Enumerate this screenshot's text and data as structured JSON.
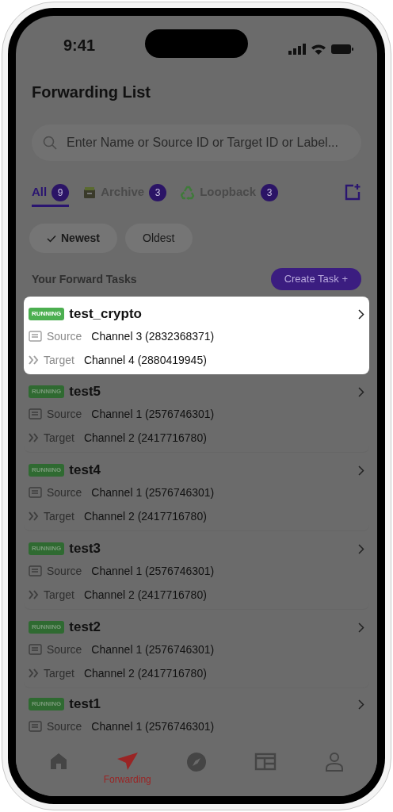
{
  "status_bar": {
    "time": "9:41"
  },
  "title": "Forwarding List",
  "search": {
    "placeholder": "Enter Name or Source ID or Target ID or Label..."
  },
  "tabs": [
    {
      "kind": "plain",
      "label": "All",
      "count": "9",
      "selected": true
    },
    {
      "kind": "archive",
      "label": "Archive",
      "count": "3",
      "selected": false
    },
    {
      "kind": "loopback",
      "label": "Loopback",
      "count": "3",
      "selected": false
    }
  ],
  "sort_chips": [
    {
      "label": "Newest",
      "selected": true
    },
    {
      "label": "Oldest",
      "selected": false
    }
  ],
  "section": {
    "title": "Your Forward Tasks",
    "button": "Create Task +"
  },
  "tasks": [
    {
      "status": "RUNNING",
      "name": "test_crypto",
      "highlighted": true,
      "source_label": "Source",
      "source": "Channel 3 (2832368371)",
      "target_label": "Target",
      "target": "Channel 4 (2880419945)"
    },
    {
      "status": "RUNNING",
      "name": "test5",
      "highlighted": false,
      "source_label": "Source",
      "source": "Channel 1 (2576746301)",
      "target_label": "Target",
      "target": "Channel 2 (2417716780)"
    },
    {
      "status": "RUNNING",
      "name": "test4",
      "highlighted": false,
      "source_label": "Source",
      "source": "Channel 1 (2576746301)",
      "target_label": "Target",
      "target": "Channel 2 (2417716780)"
    },
    {
      "status": "RUNNING",
      "name": "test3",
      "highlighted": false,
      "source_label": "Source",
      "source": "Channel 1 (2576746301)",
      "target_label": "Target",
      "target": "Channel 2 (2417716780)"
    },
    {
      "status": "RUNNING",
      "name": "test2",
      "highlighted": false,
      "source_label": "Source",
      "source": "Channel 1 (2576746301)",
      "target_label": "Target",
      "target": "Channel 2 (2417716780)"
    },
    {
      "status": "RUNNING",
      "name": "test1",
      "highlighted": false,
      "source_label": "Source",
      "source": "Channel 1 (2576746301)"
    }
  ],
  "bottom_nav": [
    {
      "kind": "home",
      "selected": false
    },
    {
      "kind": "forwarding",
      "label": "Forwarding",
      "selected": true
    },
    {
      "kind": "compass",
      "selected": false
    },
    {
      "kind": "calendar",
      "selected": false
    },
    {
      "kind": "profile",
      "selected": false
    }
  ]
}
